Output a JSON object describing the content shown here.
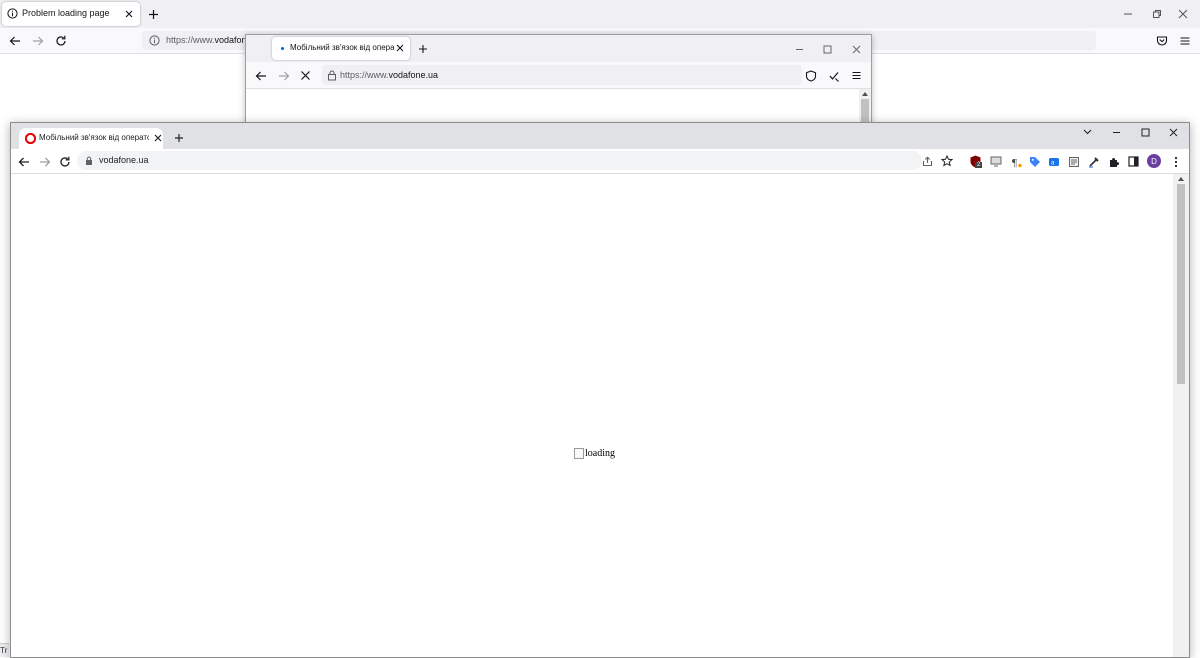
{
  "firefox_back": {
    "tab_title": "Problem loading page",
    "url_prefix": "https://www.",
    "url_domain": "vodafon"
  },
  "firefox_mid": {
    "tab_title": "Мобільний зв'язок від операто",
    "url_prefix": "https://www.",
    "url_domain": "vodafone.ua"
  },
  "chrome": {
    "tab_title": "Мобільний зв'язок від операто",
    "address": "vodafone.ua",
    "profile_initial": "D",
    "extension_badge": "2",
    "content": {
      "image_alt": "loading"
    }
  },
  "status_bar_text": "Tr",
  "colors": {
    "firefox_chrome": "#f0f0f4",
    "chrome_tabbar": "#dfe1e5",
    "opera_red": "#e60000",
    "profile_purple": "#6b3fa0"
  }
}
